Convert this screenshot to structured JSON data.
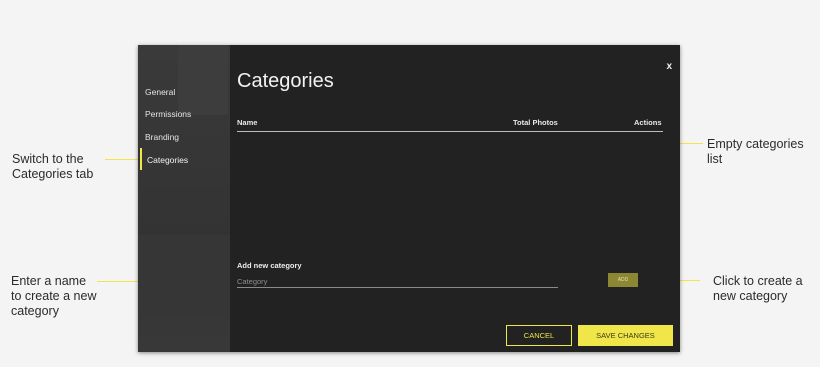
{
  "annotations": {
    "switch_tab": [
      "Switch to the",
      "Categories tab"
    ],
    "enter_name": [
      "Enter a name",
      "to create a new",
      "category"
    ],
    "empty_list": [
      "Empty categories",
      "list"
    ],
    "click_create": [
      "Click to create a",
      "new category"
    ]
  },
  "sidebar": {
    "items": [
      {
        "label": "General"
      },
      {
        "label": "Permissions"
      },
      {
        "label": "Branding"
      },
      {
        "label": "Categories"
      }
    ]
  },
  "dialog": {
    "title": "Categories",
    "close_label": "x",
    "table": {
      "columns": [
        "Name",
        "Total Photos",
        "Actions"
      ],
      "rows": []
    },
    "add_section": {
      "label": "Add new category",
      "input_placeholder": "Category",
      "input_value": "",
      "add_button": "ADD"
    },
    "cancel_button": "CANCEL",
    "save_button": "SAVE CHANGES"
  },
  "colors": {
    "accent": "#f0e64a",
    "dialog_bg": "#222222",
    "sidebar_bg": "#353535",
    "page_bg": "#f4f4f4"
  }
}
